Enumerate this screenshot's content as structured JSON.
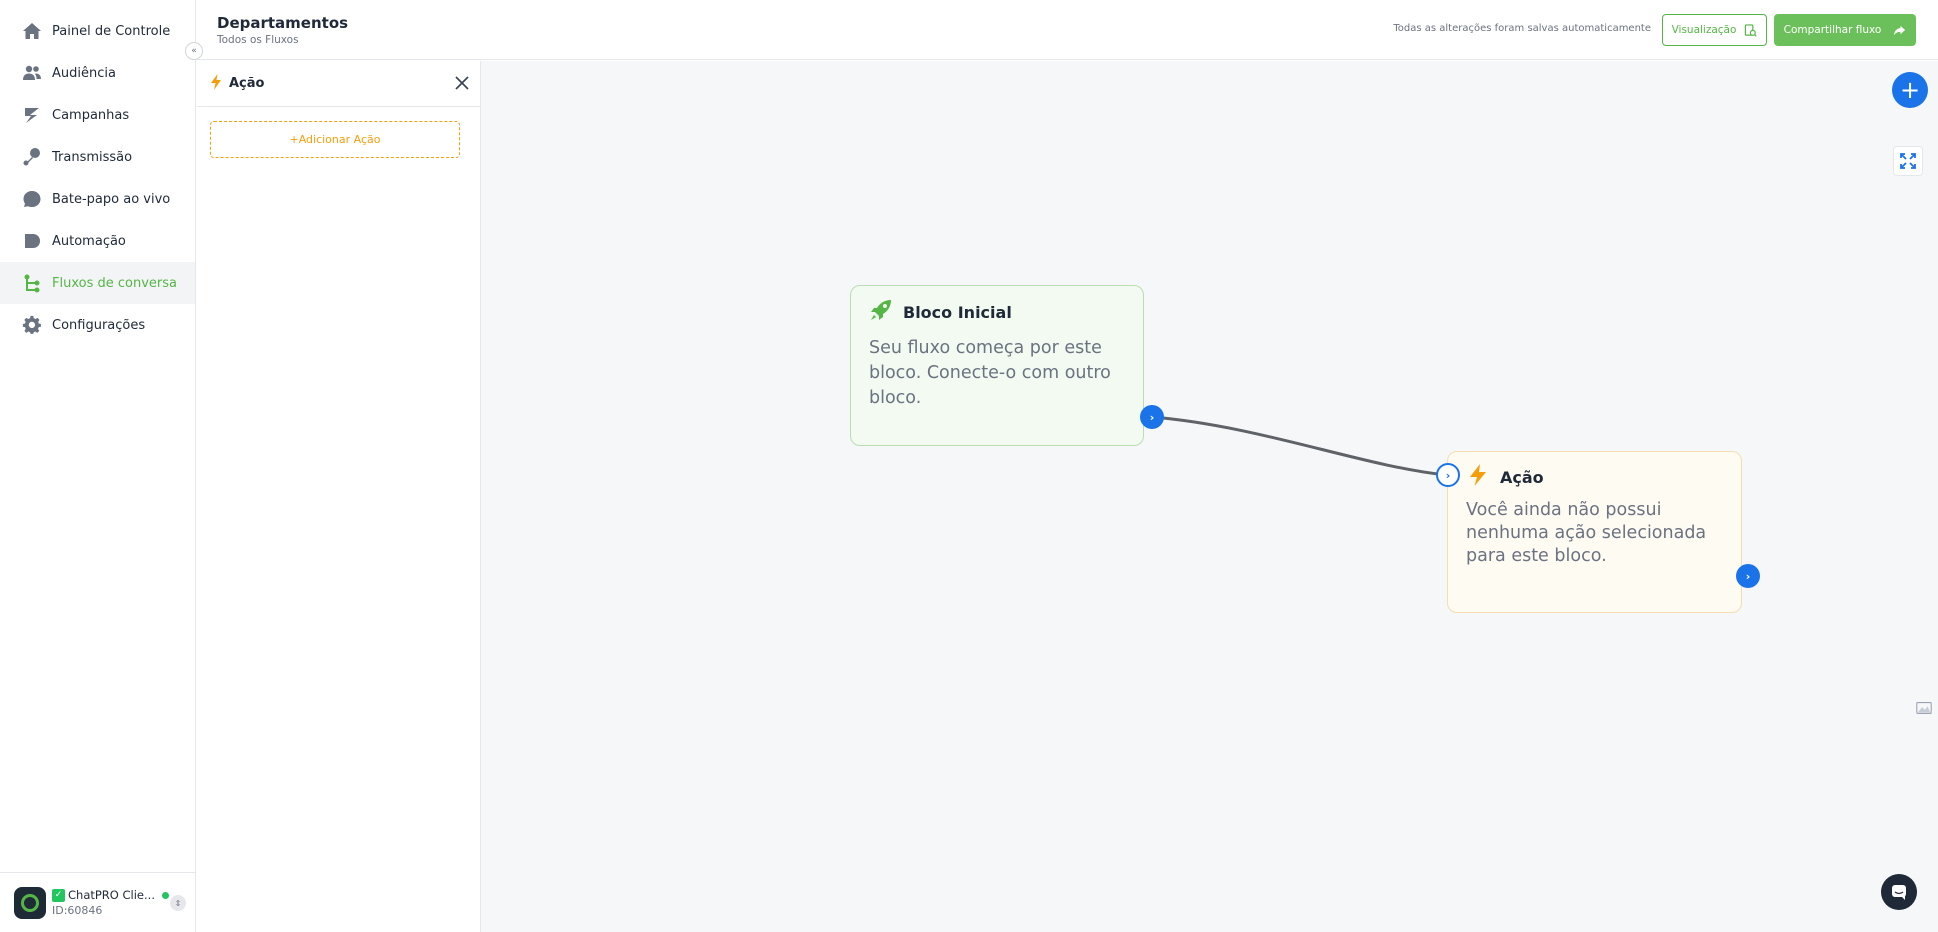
{
  "sidebar": {
    "items": [
      {
        "label": "Painel de Controle",
        "icon": "home-icon"
      },
      {
        "label": "Audiência",
        "icon": "users-icon"
      },
      {
        "label": "Campanhas",
        "icon": "campaign-icon"
      },
      {
        "label": "Transmissão",
        "icon": "broadcast-icon"
      },
      {
        "label": "Bate-papo ao vivo",
        "icon": "chat-icon"
      },
      {
        "label": "Automação",
        "icon": "automation-icon"
      },
      {
        "label": "Fluxos de conversa",
        "icon": "flow-icon",
        "active": true
      },
      {
        "label": "Configurações",
        "icon": "gear-icon"
      }
    ],
    "collapse_glyph": "«",
    "account": {
      "name": "ChatPRO Clie...",
      "check": "✓",
      "id": "ID:60846",
      "toggle_glyph": "⇕"
    }
  },
  "header": {
    "title": "Departamentos",
    "breadcrumb": "Todos os Fluxos",
    "autosave": "Todas as alterações foram salvas automaticamente",
    "preview_label": "Visualização",
    "share_label": "Compartilhar fluxo"
  },
  "panel": {
    "title": "Ação",
    "add_action_label": "+Adicionar Ação"
  },
  "canvas": {
    "start_block": {
      "title": "Bloco Inicial",
      "description": "Seu fluxo começa por este bloco. Conecte-o com outro bloco."
    },
    "action_block": {
      "title": "Ação",
      "description": "Você ainda não possui nenhuma ação selecionada para este bloco."
    },
    "port_glyph": "›",
    "add_glyph": "+"
  },
  "colors": {
    "brand_green": "#55b646",
    "accent_blue": "#1a73e8",
    "action_orange": "#f59e0b"
  }
}
